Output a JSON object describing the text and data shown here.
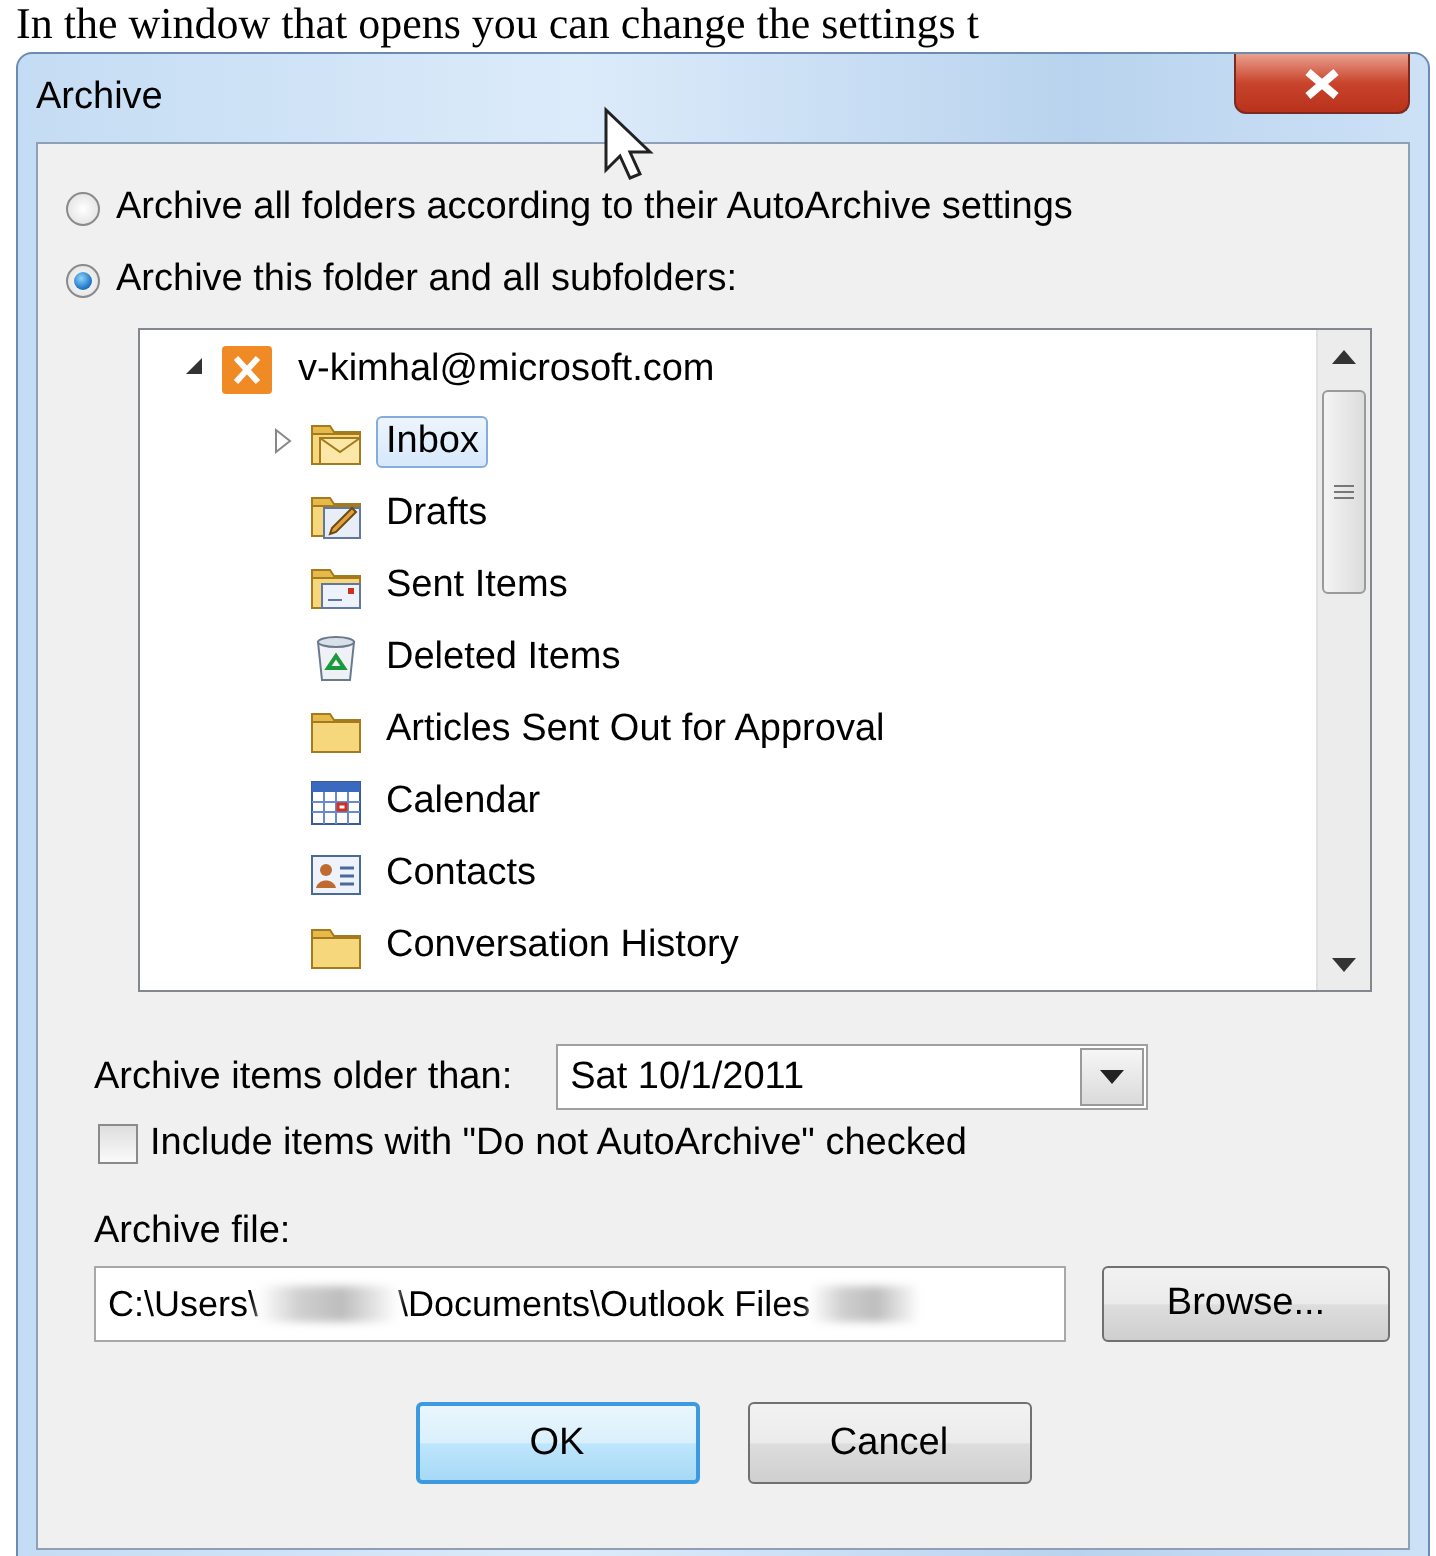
{
  "caption": "In the window that opens you can change the settings t",
  "window": {
    "title": "Archive"
  },
  "options": [
    {
      "label": "Archive all folders according to their AutoArchive settings",
      "selected": false
    },
    {
      "label": "Archive this folder and all subfolders:",
      "selected": true
    }
  ],
  "folder_tree": [
    {
      "label": "v-kimhal@microsoft.com",
      "kind": "account",
      "expanded": true,
      "selected": false,
      "children": [
        {
          "label": "Inbox",
          "kind": "inbox",
          "expanded": false,
          "selected": true
        },
        {
          "label": "Drafts",
          "kind": "drafts",
          "selected": false
        },
        {
          "label": "Sent Items",
          "kind": "sent",
          "selected": false
        },
        {
          "label": "Deleted Items",
          "kind": "deleted",
          "selected": false
        },
        {
          "label": "Articles Sent Out for Approval",
          "kind": "folder",
          "selected": false
        },
        {
          "label": "Calendar",
          "kind": "calendar",
          "selected": false
        },
        {
          "label": "Contacts",
          "kind": "contacts",
          "selected": false
        },
        {
          "label": "Conversation History",
          "kind": "folder",
          "selected": false
        }
      ]
    }
  ],
  "older_than": {
    "label": "Archive items older than:",
    "value": "Sat 10/1/2011"
  },
  "include_checkbox": {
    "label": "Include items with \"Do not AutoArchive\" checked",
    "checked": false
  },
  "archive_file": {
    "label": "Archive file:",
    "path": [
      {
        "kind": "text",
        "text": "C:\\Users\\"
      },
      {
        "kind": "redacted"
      },
      {
        "kind": "text",
        "text": "\\Documents\\Outlook Files"
      },
      {
        "kind": "redacted"
      }
    ],
    "button": "Browse..."
  },
  "buttons": [
    {
      "label": "OK",
      "default": true
    },
    {
      "label": "Cancel",
      "default": false
    }
  ]
}
